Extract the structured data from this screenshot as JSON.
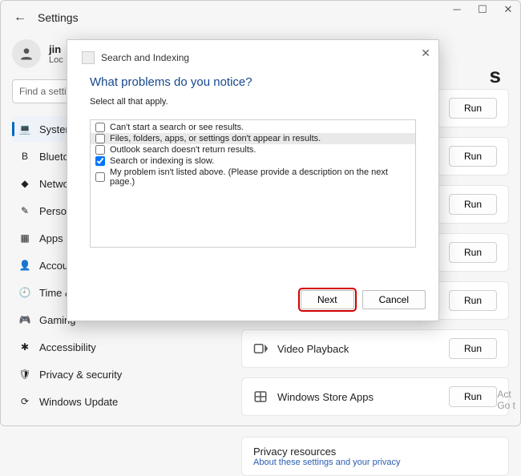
{
  "window": {
    "title": "Settings"
  },
  "user": {
    "name": "jin",
    "sub": "Loc"
  },
  "search": {
    "placeholder": "Find a setting"
  },
  "nav": {
    "items": [
      {
        "label": "System",
        "icon": "💻",
        "key": "system"
      },
      {
        "label": "Bluetooth",
        "icon": "B",
        "key": "bluetooth"
      },
      {
        "label": "Network",
        "icon": "◆",
        "key": "network"
      },
      {
        "label": "Personal",
        "icon": "✎",
        "key": "personalization"
      },
      {
        "label": "Apps",
        "icon": "▦",
        "key": "apps"
      },
      {
        "label": "Account",
        "icon": "👤",
        "key": "accounts"
      },
      {
        "label": "Time & l",
        "icon": "🕘",
        "key": "time"
      },
      {
        "label": "Gaming",
        "icon": "🎮",
        "key": "gaming"
      },
      {
        "label": "Accessibility",
        "icon": "✱",
        "key": "accessibility"
      },
      {
        "label": "Privacy & security",
        "icon": "🛡",
        "key": "privacy"
      },
      {
        "label": "Windows Update",
        "icon": "⟳",
        "key": "update"
      }
    ]
  },
  "content": {
    "header_fragment": "s",
    "cards": [
      {
        "label": "",
        "run": "Run"
      },
      {
        "label": "",
        "run": "Run"
      },
      {
        "label": "",
        "run": "Run"
      },
      {
        "label": "",
        "run": "Run"
      },
      {
        "label": "",
        "run": "Run"
      },
      {
        "label": "Video Playback",
        "run": "Run"
      },
      {
        "label": "Windows Store Apps",
        "run": "Run"
      }
    ],
    "resources": {
      "title": "Privacy resources",
      "sub": "About these settings and your privacy"
    }
  },
  "dialog": {
    "title": "Search and Indexing",
    "question": "What problems do you notice?",
    "subtitle": "Select all that apply.",
    "options": [
      {
        "label": "Can't start a search or see results.",
        "checked": false
      },
      {
        "label": "Files, folders, apps, or settings don't appear in results.",
        "checked": false,
        "highlight": true
      },
      {
        "label": "Outlook search doesn't return results.",
        "checked": false
      },
      {
        "label": "Search or indexing is slow.",
        "checked": true
      },
      {
        "label": "My problem isn't listed above. (Please provide a description on the next page.)",
        "checked": false
      }
    ],
    "next": "Next",
    "cancel": "Cancel"
  },
  "watermark": {
    "l1": "Act",
    "l2": "Go t"
  }
}
